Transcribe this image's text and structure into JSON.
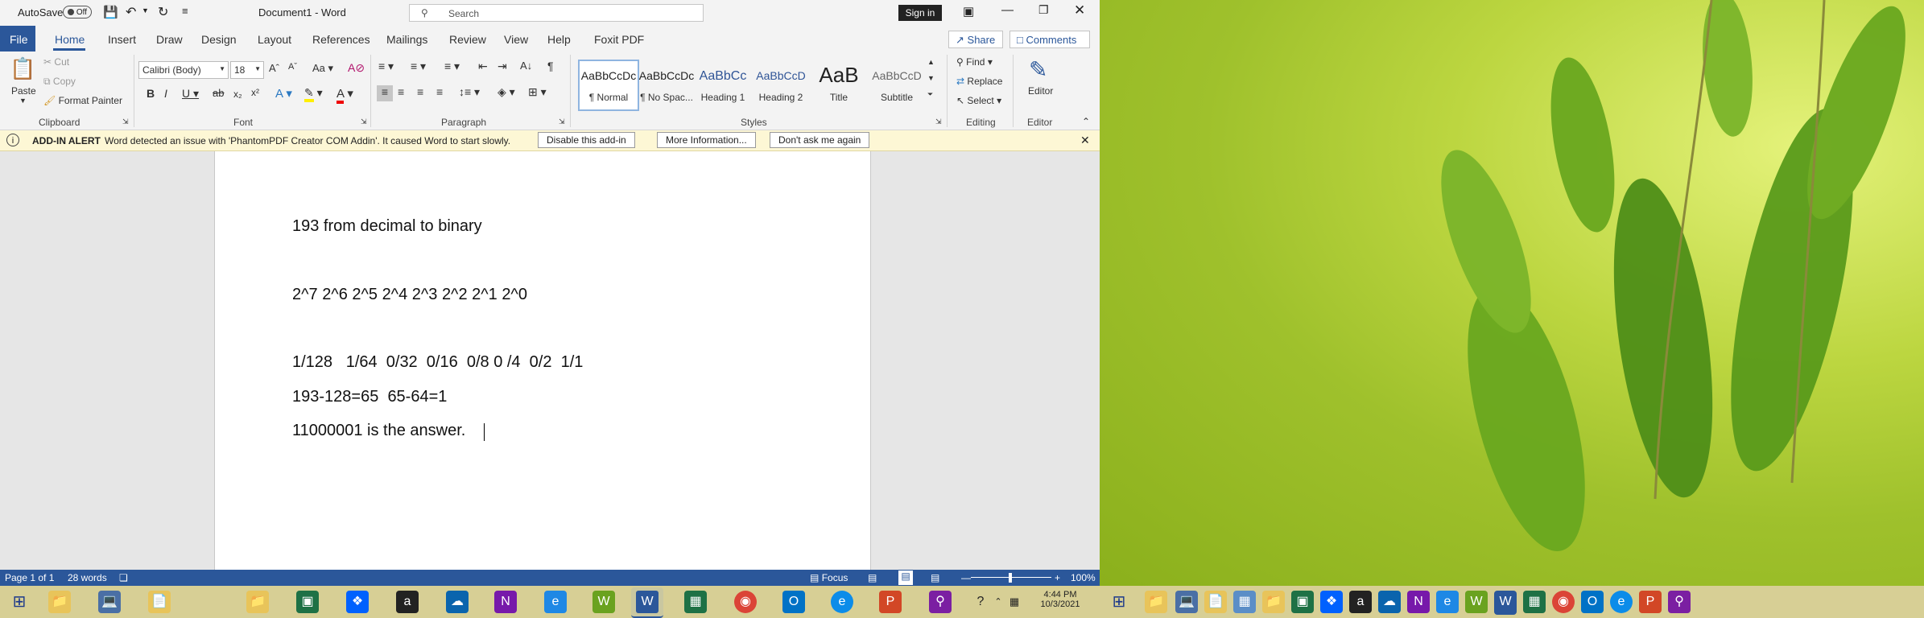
{
  "titlebar": {
    "autosave_label": "AutoSave",
    "autosave_state": "Off",
    "doc_title": "Document1 - Word",
    "search_placeholder": "Search",
    "signin_label": "Sign in"
  },
  "ribbon_tabs": [
    "File",
    "Home",
    "Insert",
    "Draw",
    "Design",
    "Layout",
    "References",
    "Mailings",
    "Review",
    "View",
    "Help",
    "Foxit PDF"
  ],
  "share_label": "Share",
  "comments_label": "Comments",
  "clipboard": {
    "paste": "Paste",
    "cut": "Cut",
    "copy": "Copy",
    "format_painter": "Format Painter",
    "label": "Clipboard"
  },
  "font": {
    "family": "Calibri (Body)",
    "size": "18",
    "label": "Font",
    "case": "Aa"
  },
  "paragraph": {
    "label": "Paragraph"
  },
  "styles": {
    "label": "Styles",
    "items": [
      {
        "sample": "AaBbCcDc",
        "name": "¶ Normal"
      },
      {
        "sample": "AaBbCcDc",
        "name": "¶ No Spac..."
      },
      {
        "sample": "AaBbCc",
        "name": "Heading 1"
      },
      {
        "sample": "AaBbCcD",
        "name": "Heading 2"
      },
      {
        "sample": "AaB",
        "name": "Title"
      },
      {
        "sample": "AaBbCcD",
        "name": "Subtitle"
      }
    ]
  },
  "editing": {
    "find": "Find",
    "replace": "Replace",
    "select": "Select",
    "label": "Editing"
  },
  "editor": {
    "button": "Editor",
    "label": "Editor"
  },
  "alert": {
    "title": "ADD-IN ALERT",
    "message": "Word detected an issue with 'PhantomPDF Creator COM Addin'. It caused Word to start slowly.",
    "btn_disable": "Disable this add-in",
    "btn_more": "More Information...",
    "btn_dont_ask": "Don't ask me again"
  },
  "document": {
    "lines": [
      "193 from decimal to binary",
      "2^7 2^6 2^5 2^4 2^3 2^2 2^1 2^0",
      "1/128   1/64  0/32  0/16  0/8 0 /4  0/2  1/1",
      "193-128=65  65-64=1",
      "11000001 is the answer."
    ]
  },
  "status": {
    "page": "Page 1 of 1",
    "words": "28 words",
    "focus": "Focus",
    "zoom": "100%"
  },
  "taskbar": {
    "time": "4:44 PM",
    "date": "10/3/2021"
  }
}
